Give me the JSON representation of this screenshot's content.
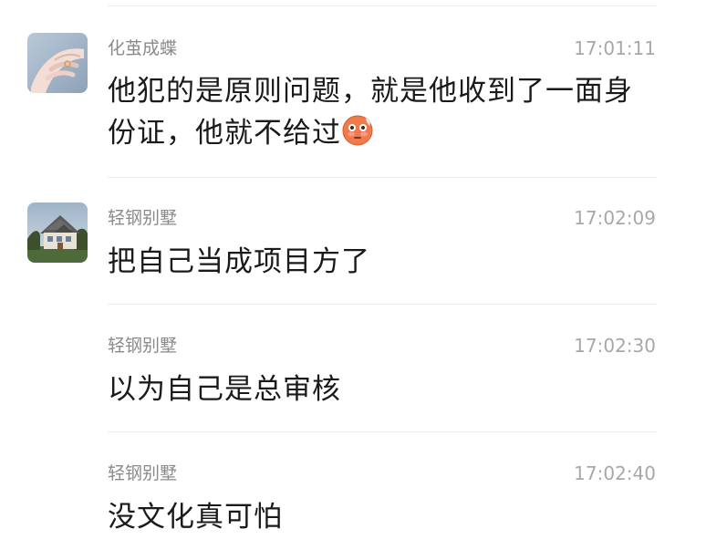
{
  "messages": [
    {
      "sender": "化茧成蝶",
      "time": "17:01:11",
      "text": "他犯的是原则问题，就是他收到了一面身份证，他就不给过",
      "emoji": "flushed-face-emoji",
      "avatar": "hand-avatar"
    },
    {
      "sender": "轻钢别墅",
      "time": "17:02:09",
      "text": "把自己当成项目方了",
      "avatar": "house-avatar"
    },
    {
      "sender": "轻钢别墅",
      "time": "17:02:30",
      "text": "以为自己是总审核"
    },
    {
      "sender": "轻钢别墅",
      "time": "17:02:40",
      "text": "没文化真可怕"
    }
  ]
}
